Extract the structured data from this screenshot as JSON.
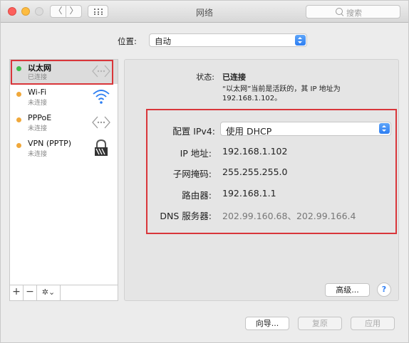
{
  "window": {
    "title": "网络"
  },
  "toolbar": {
    "back_glyph": "〈",
    "forward_glyph": "〉",
    "grid_icon": "grid-icon"
  },
  "search": {
    "placeholder": "搜索"
  },
  "location": {
    "label": "位置:",
    "value": "自动"
  },
  "sidebar": {
    "items": [
      {
        "name": "以太网",
        "status": "已连接",
        "dot_color": "#3fbd4b",
        "icon": "ethernet-icon",
        "selected": true
      },
      {
        "name": "Wi-Fi",
        "status": "未连接",
        "dot_color": "#f0a83b",
        "icon": "wifi-icon",
        "selected": false
      },
      {
        "name": "PPPoE",
        "status": "未连接",
        "dot_color": "#f0a83b",
        "icon": "pppoe-icon",
        "selected": false
      },
      {
        "name": "VPN (PPTP)",
        "status": "未连接",
        "dot_color": "#f0a83b",
        "icon": "vpn-lock-icon",
        "selected": false
      }
    ],
    "tools": {
      "add": "+",
      "remove": "−",
      "gear": "✲⌄"
    }
  },
  "detail": {
    "status_label": "状态:",
    "status_value": "已连接",
    "status_description": "“以太网”当前是活跃的，其 IP 地址为 192.168.1.102。",
    "configure_label": "配置 IPv4:",
    "configure_value": "使用 DHCP",
    "ip_label": "IP 地址:",
    "ip_value": "192.168.1.102",
    "subnet_label": "子网掩码:",
    "subnet_value": "255.255.255.0",
    "router_label": "路由器:",
    "router_value": "192.168.1.1",
    "dns_label": "DNS 服务器:",
    "dns_value": "202.99.160.68、202.99.166.4"
  },
  "buttons": {
    "advanced": "高级...",
    "help": "?",
    "assist": "向导...",
    "revert": "复原",
    "apply": "应用"
  },
  "colors": {
    "highlight": "#d9363a",
    "accent": "#2d7ef2"
  }
}
